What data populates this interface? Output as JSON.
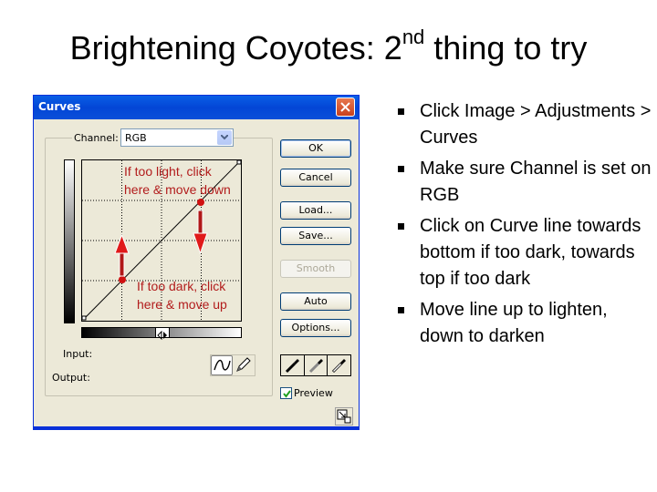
{
  "slide": {
    "title_main": "Brightening Coyotes: 2",
    "title_sup": "nd",
    "title_rest": " thing to try"
  },
  "dialog": {
    "title": "Curves",
    "channel_label": "Channel:",
    "channel_value": "RGB",
    "buttons": {
      "ok": "OK",
      "cancel": "Cancel",
      "load": "Load...",
      "save": "Save...",
      "smooth": "Smooth",
      "auto": "Auto",
      "options": "Options..."
    },
    "input_label": "Input:",
    "output_label": "Output:",
    "preview_label": "Preview",
    "preview_checked": true,
    "annotations": {
      "light_line1": "If too light, click",
      "light_line2": "here & move down",
      "dark_line1": "If too dark, click",
      "dark_line2": "here & move up"
    },
    "colors": {
      "title_bar": "#0346d6",
      "annotation": "#b21c1c",
      "close_button": "#d6552b"
    }
  },
  "bullets": [
    "Click Image > Adjustments > Curves",
    "Make sure Channel is set on RGB",
    "Click on Curve line towards bottom if too dark, towards top if too dark",
    "Move line up to lighten, down to darken"
  ]
}
